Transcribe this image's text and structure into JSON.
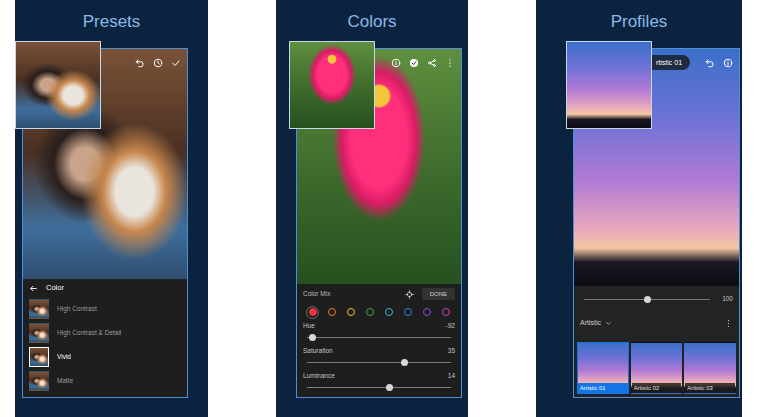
{
  "presets": {
    "title": "Presets",
    "category": "Color",
    "items": [
      {
        "label": "High Contrast",
        "selected": false
      },
      {
        "label": "High Contrast & Detail",
        "selected": false
      },
      {
        "label": "Vivid",
        "selected": true
      },
      {
        "label": "Matte",
        "selected": false
      }
    ]
  },
  "colors": {
    "title": "Colors",
    "panel": "Color Mix",
    "done": "DONE",
    "swatches": [
      {
        "color": "#e8343f",
        "selected": true
      },
      {
        "color": "#f27b2c",
        "selected": false
      },
      {
        "color": "#efc12a",
        "selected": false
      },
      {
        "color": "#3db04a",
        "selected": false
      },
      {
        "color": "#2fc0c0",
        "selected": false
      },
      {
        "color": "#2f7be8",
        "selected": false
      },
      {
        "color": "#8a4ae0",
        "selected": false
      },
      {
        "color": "#d040b0",
        "selected": false
      }
    ],
    "sliders": [
      {
        "label": "Hue",
        "reading": "-92",
        "level": 0.04
      },
      {
        "label": "Saturation",
        "reading": "35",
        "level": 0.68
      },
      {
        "label": "Luminance",
        "reading": "14",
        "level": 0.57
      }
    ]
  },
  "profiles": {
    "title": "Profiles",
    "current": "rtistic 01",
    "amount": {
      "reading": "100",
      "level": 0.5
    },
    "group": "Artistic",
    "items": [
      {
        "label": "Artistic 01",
        "selected": true
      },
      {
        "label": "Artistic 02",
        "selected": false
      },
      {
        "label": "Artistic 03",
        "selected": false
      }
    ]
  }
}
